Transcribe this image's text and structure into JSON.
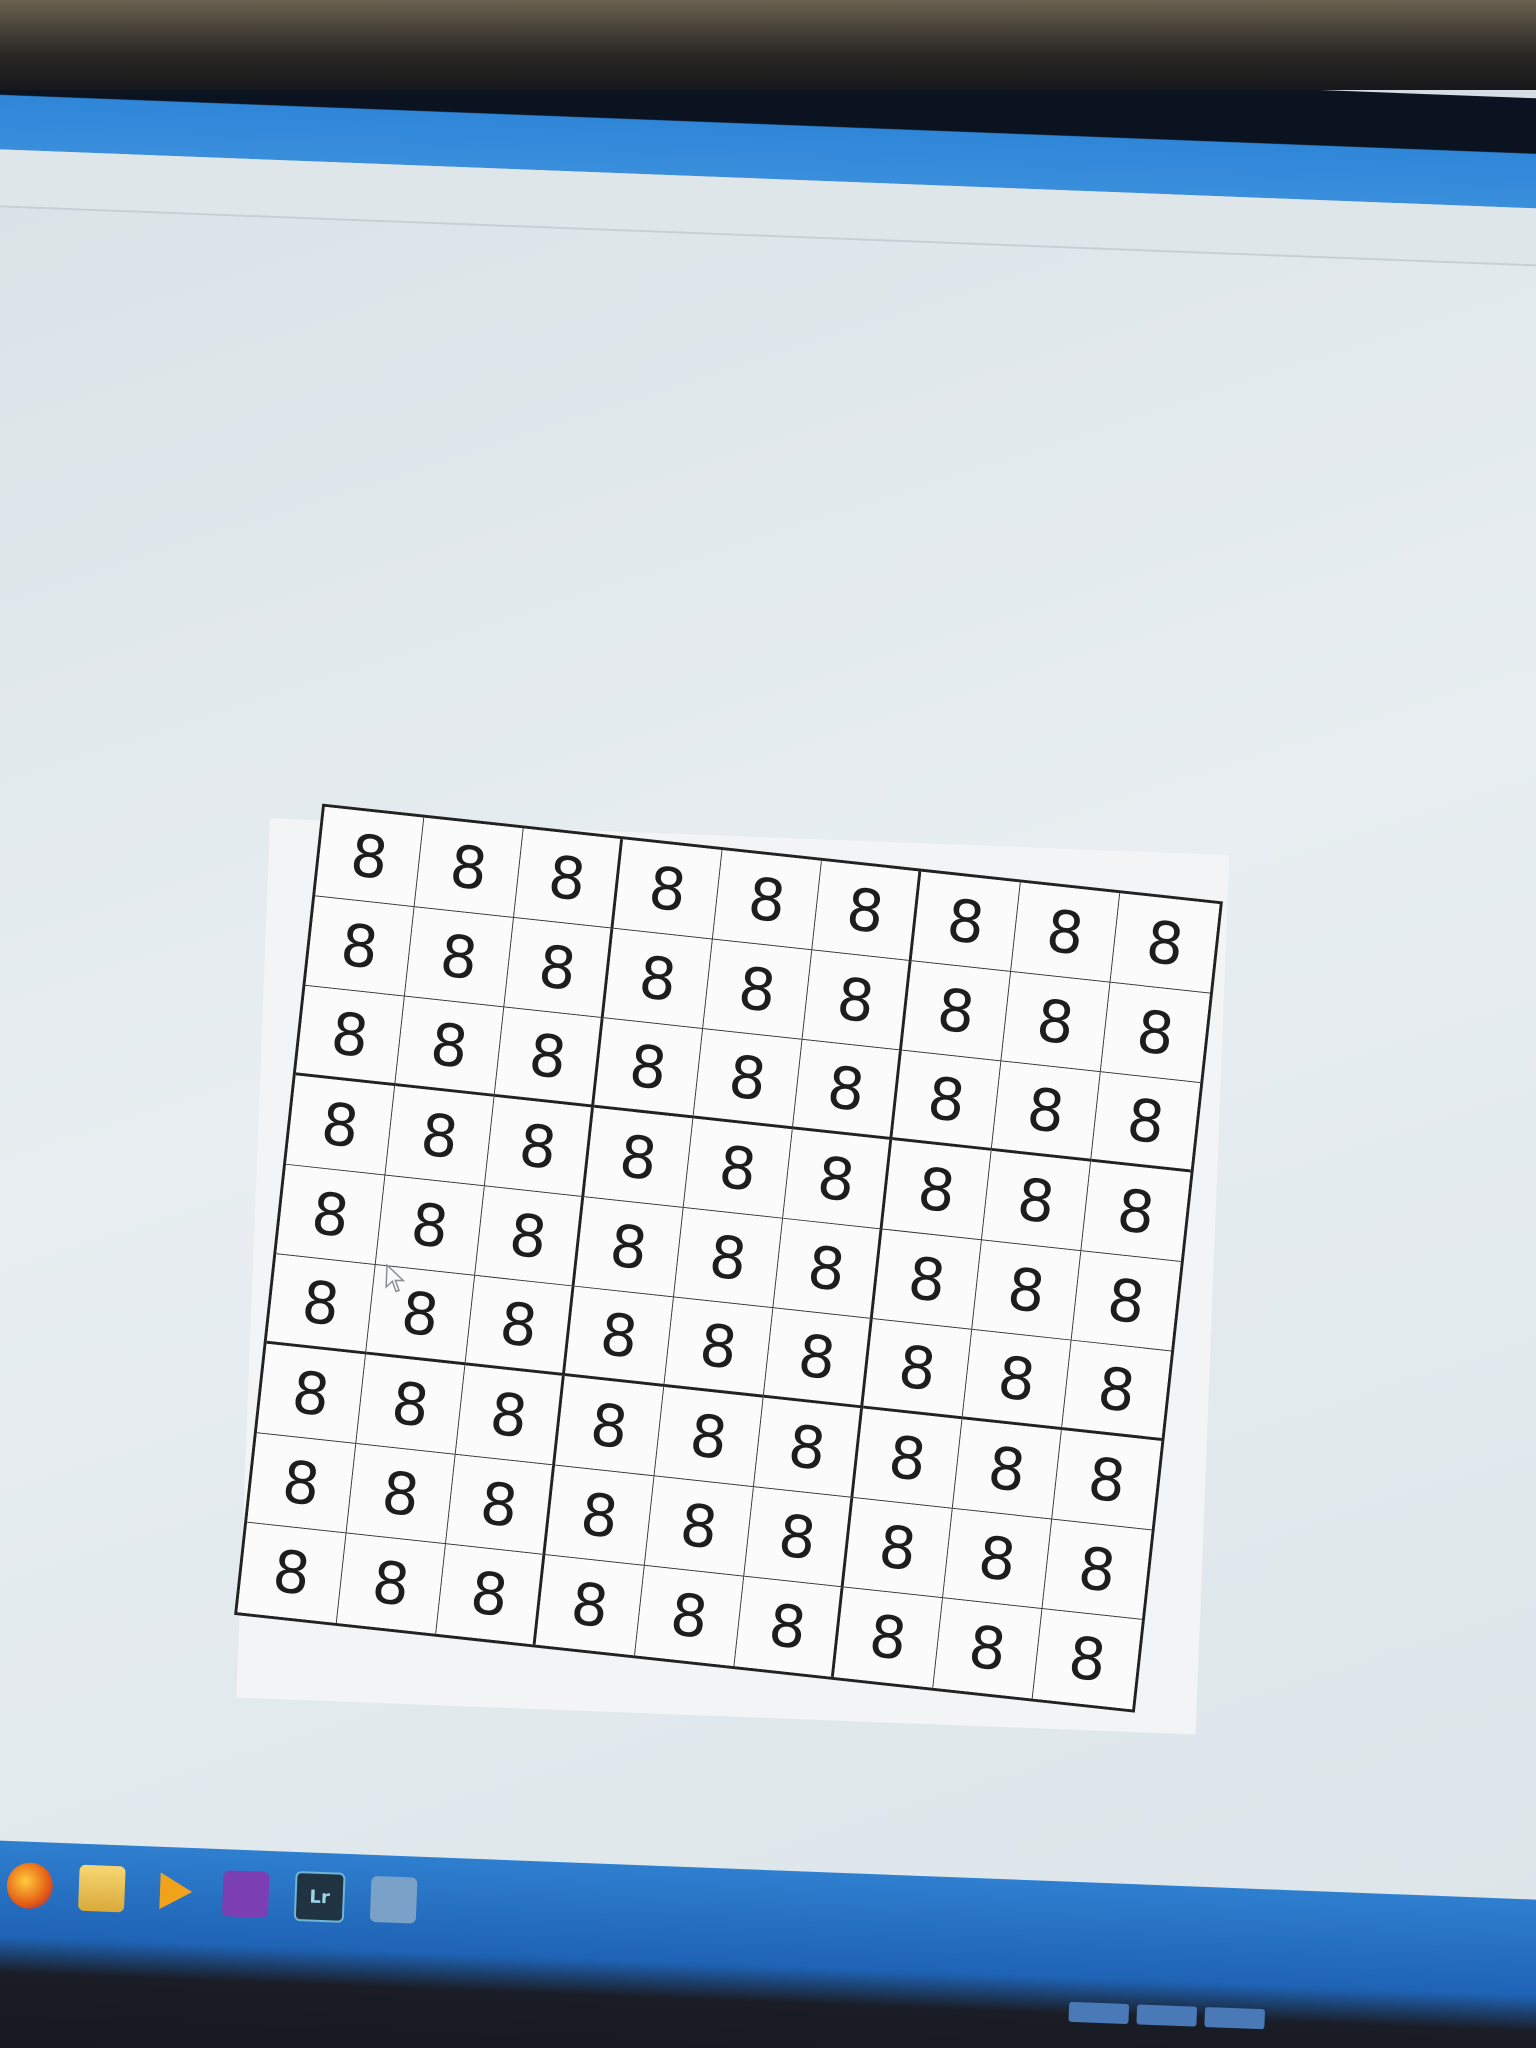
{
  "sudoku": {
    "rows": [
      [
        "8",
        "8",
        "8",
        "8",
        "8",
        "8",
        "8",
        "8",
        "8"
      ],
      [
        "8",
        "8",
        "8",
        "8",
        "8",
        "8",
        "8",
        "8",
        "8"
      ],
      [
        "8",
        "8",
        "8",
        "8",
        "8",
        "8",
        "8",
        "8",
        "8"
      ],
      [
        "8",
        "8",
        "8",
        "8",
        "8",
        "8",
        "8",
        "8",
        "8"
      ],
      [
        "8",
        "8",
        "8",
        "8",
        "8",
        "8",
        "8",
        "8",
        "8"
      ],
      [
        "8",
        "8",
        "8",
        "8",
        "8",
        "8",
        "8",
        "8",
        "8"
      ],
      [
        "8",
        "8",
        "8",
        "8",
        "8",
        "8",
        "8",
        "8",
        "8"
      ],
      [
        "8",
        "8",
        "8",
        "8",
        "8",
        "8",
        "8",
        "8",
        "8"
      ],
      [
        "8",
        "8",
        "8",
        "8",
        "8",
        "8",
        "8",
        "8",
        "8"
      ]
    ]
  },
  "taskbar": {
    "icons": [
      "start-icon",
      "firefox-icon",
      "file-explorer-icon",
      "media-player-icon",
      "visual-studio-icon",
      "lightroom-icon",
      "app-window-icon"
    ],
    "lightroom_label": "Lr"
  },
  "colors": {
    "title_bar": "#3a8fdc",
    "taskbar": "#1f63b5",
    "grid_line": "#222222",
    "cell_bg": "#fbfbfb"
  }
}
